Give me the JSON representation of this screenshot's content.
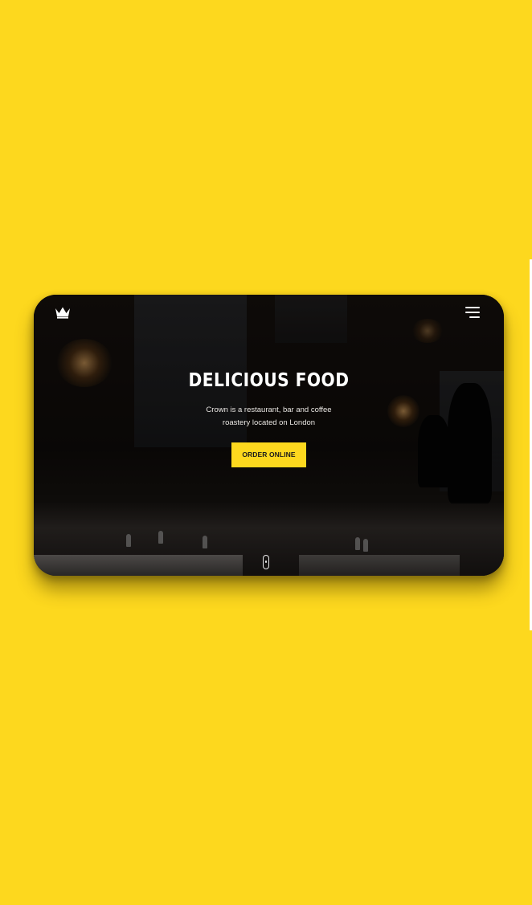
{
  "hero": {
    "title": "DELICIOUS FOOD",
    "subtitle": "Crown is a restaurant, bar and coffee roastery located on London",
    "cta_label": "ORDER ONLINE"
  },
  "icons": {
    "logo": "crown-icon",
    "menu": "hamburger-menu-icon",
    "scroll": "mouse-scroll-icon"
  },
  "colors": {
    "background": "#fdd81e",
    "accent": "#fdd81e",
    "button_text": "#1b1b1b",
    "hero_text": "#ffffff"
  }
}
